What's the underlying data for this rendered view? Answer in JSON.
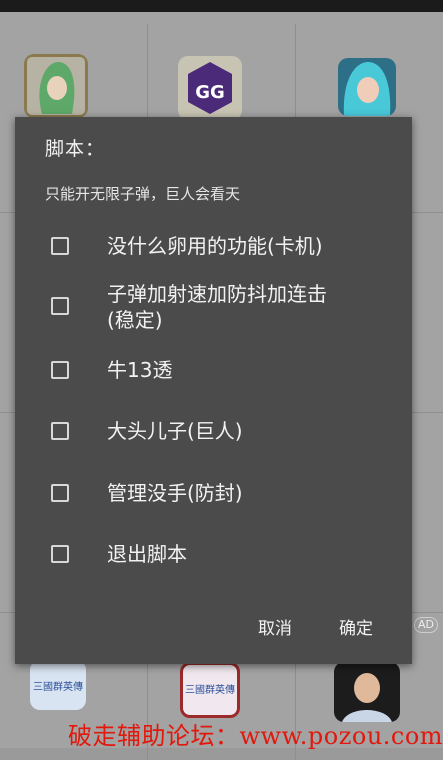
{
  "dialog": {
    "title": "脚本：",
    "message": "只能开无限子弹，巨人会看天",
    "options": [
      {
        "label": "没什么卵用的功能(卡机)",
        "checked": false
      },
      {
        "label": "子弹加射速加防抖加连击\n(稳定)",
        "checked": false
      },
      {
        "label": "牛13透",
        "checked": false
      },
      {
        "label": "大头儿子(巨人)",
        "checked": false
      },
      {
        "label": "管理没手(防封)",
        "checked": false
      },
      {
        "label": "退出脚本",
        "checked": false
      }
    ],
    "cancel_label": "取消",
    "confirm_label": "确定"
  },
  "background": {
    "ad_badge": "AD",
    "tile_bottom_1_text": "三國群英傳",
    "tile_bottom_2_text": "三國群英傳"
  },
  "watermark": "破走辅助论坛：www.pozou.com",
  "colors": {
    "dialog_bg": "#4b4b4b",
    "watermark": "#e2180c",
    "gg_purple": "#4b2a7a"
  },
  "icons": [
    "character-green-hair-icon",
    "gg-game-guardian-icon",
    "character-blue-hair-icon",
    "avatar-icon"
  ]
}
